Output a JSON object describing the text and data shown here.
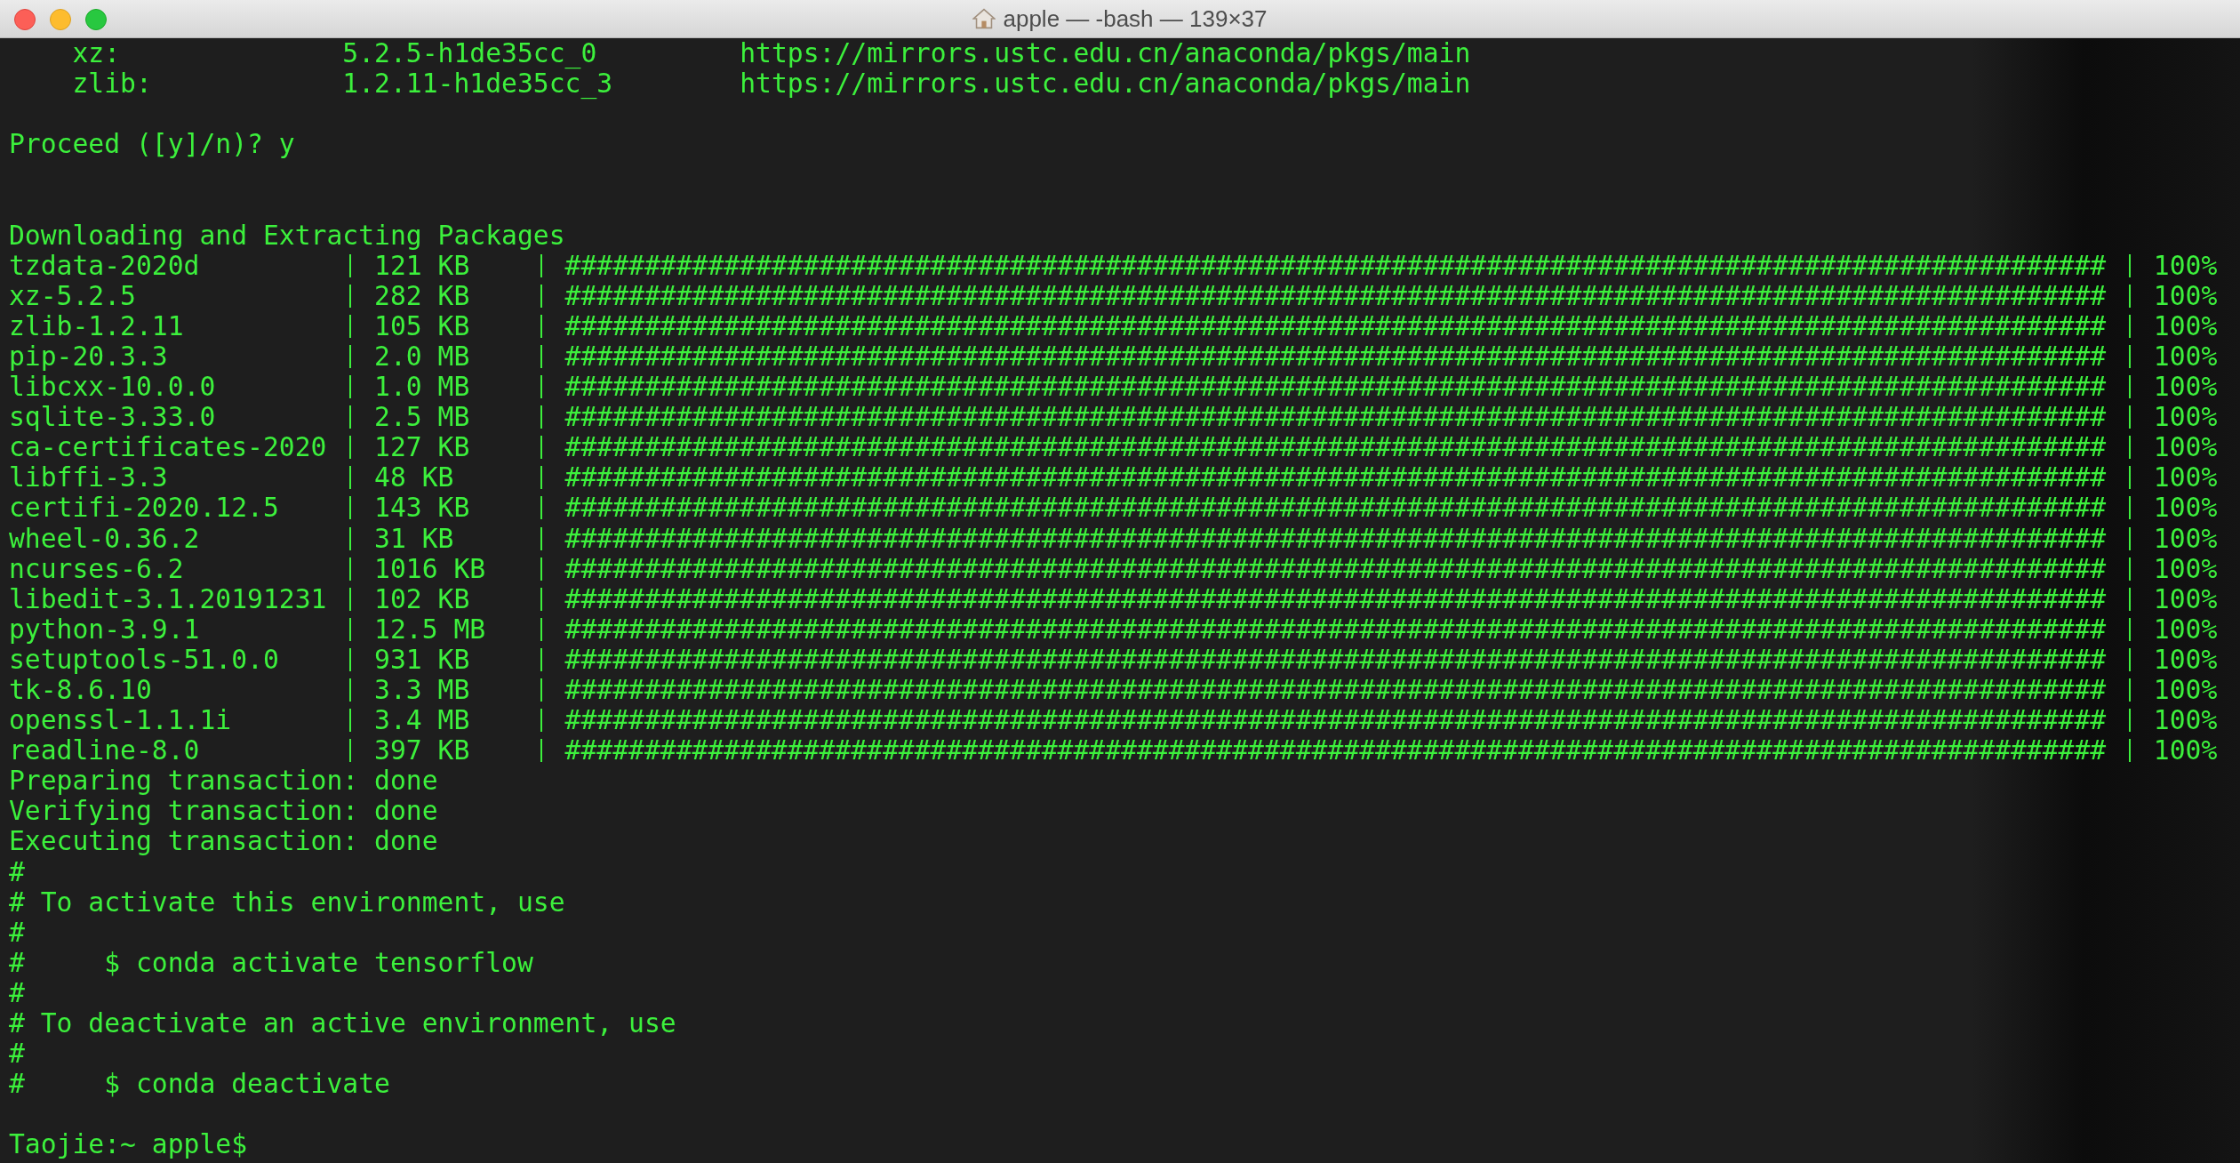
{
  "window": {
    "title": "apple — -bash — 139×37"
  },
  "lines": [
    {
      "kind": "spec",
      "name": "xz:",
      "version": "5.2.5-h1de35cc_0",
      "channel": "https://mirrors.ustc.edu.cn/anaconda/pkgs/main"
    },
    {
      "kind": "spec",
      "name": "zlib:",
      "version": "1.2.11-h1de35cc_3",
      "channel": "https://mirrors.ustc.edu.cn/anaconda/pkgs/main"
    },
    {
      "kind": "blank"
    },
    {
      "kind": "text",
      "text": "Proceed ([y]/n)? y"
    },
    {
      "kind": "blank"
    },
    {
      "kind": "blank"
    },
    {
      "kind": "text",
      "text": "Downloading and Extracting Packages"
    },
    {
      "kind": "download",
      "name": "tzdata-2020d",
      "size": "121 KB",
      "bar": "#################################################################################################",
      "percent": "100%"
    },
    {
      "kind": "download",
      "name": "xz-5.2.5",
      "size": "282 KB",
      "bar": "#################################################################################################",
      "percent": "100%"
    },
    {
      "kind": "download",
      "name": "zlib-1.2.11",
      "size": "105 KB",
      "bar": "#################################################################################################",
      "percent": "100%"
    },
    {
      "kind": "download",
      "name": "pip-20.3.3",
      "size": "2.0 MB",
      "bar": "#################################################################################################",
      "percent": "100%"
    },
    {
      "kind": "download",
      "name": "libcxx-10.0.0",
      "size": "1.0 MB",
      "bar": "#################################################################################################",
      "percent": "100%"
    },
    {
      "kind": "download",
      "name": "sqlite-3.33.0",
      "size": "2.5 MB",
      "bar": "#################################################################################################",
      "percent": "100%"
    },
    {
      "kind": "download",
      "name": "ca-certificates-2020",
      "size": "127 KB",
      "bar": "#################################################################################################",
      "percent": "100%"
    },
    {
      "kind": "download",
      "name": "libffi-3.3",
      "size": "48 KB",
      "bar": "#################################################################################################",
      "percent": "100%"
    },
    {
      "kind": "download",
      "name": "certifi-2020.12.5",
      "size": "143 KB",
      "bar": "#################################################################################################",
      "percent": "100%"
    },
    {
      "kind": "download",
      "name": "wheel-0.36.2",
      "size": "31 KB",
      "bar": "#################################################################################################",
      "percent": "100%"
    },
    {
      "kind": "download",
      "name": "ncurses-6.2",
      "size": "1016 KB",
      "bar": "#################################################################################################",
      "percent": "100%"
    },
    {
      "kind": "download",
      "name": "libedit-3.1.20191231",
      "size": "102 KB",
      "bar": "#################################################################################################",
      "percent": "100%"
    },
    {
      "kind": "download",
      "name": "python-3.9.1",
      "size": "12.5 MB",
      "bar": "#################################################################################################",
      "percent": "100%"
    },
    {
      "kind": "download",
      "name": "setuptools-51.0.0",
      "size": "931 KB",
      "bar": "#################################################################################################",
      "percent": "100%"
    },
    {
      "kind": "download",
      "name": "tk-8.6.10",
      "size": "3.3 MB",
      "bar": "#################################################################################################",
      "percent": "100%"
    },
    {
      "kind": "download",
      "name": "openssl-1.1.1i",
      "size": "3.4 MB",
      "bar": "#################################################################################################",
      "percent": "100%"
    },
    {
      "kind": "download",
      "name": "readline-8.0",
      "size": "397 KB",
      "bar": "#################################################################################################",
      "percent": "100%"
    },
    {
      "kind": "text",
      "text": "Preparing transaction: done"
    },
    {
      "kind": "text",
      "text": "Verifying transaction: done"
    },
    {
      "kind": "text",
      "text": "Executing transaction: done"
    },
    {
      "kind": "text",
      "text": "#"
    },
    {
      "kind": "text",
      "text": "# To activate this environment, use"
    },
    {
      "kind": "text",
      "text": "#"
    },
    {
      "kind": "text",
      "text": "#     $ conda activate tensorflow"
    },
    {
      "kind": "text",
      "text": "#"
    },
    {
      "kind": "text",
      "text": "# To deactivate an active environment, use"
    },
    {
      "kind": "text",
      "text": "#"
    },
    {
      "kind": "text",
      "text": "#     $ conda deactivate"
    },
    {
      "kind": "blank"
    },
    {
      "kind": "text",
      "text": "Taojie:~ apple$"
    }
  ]
}
